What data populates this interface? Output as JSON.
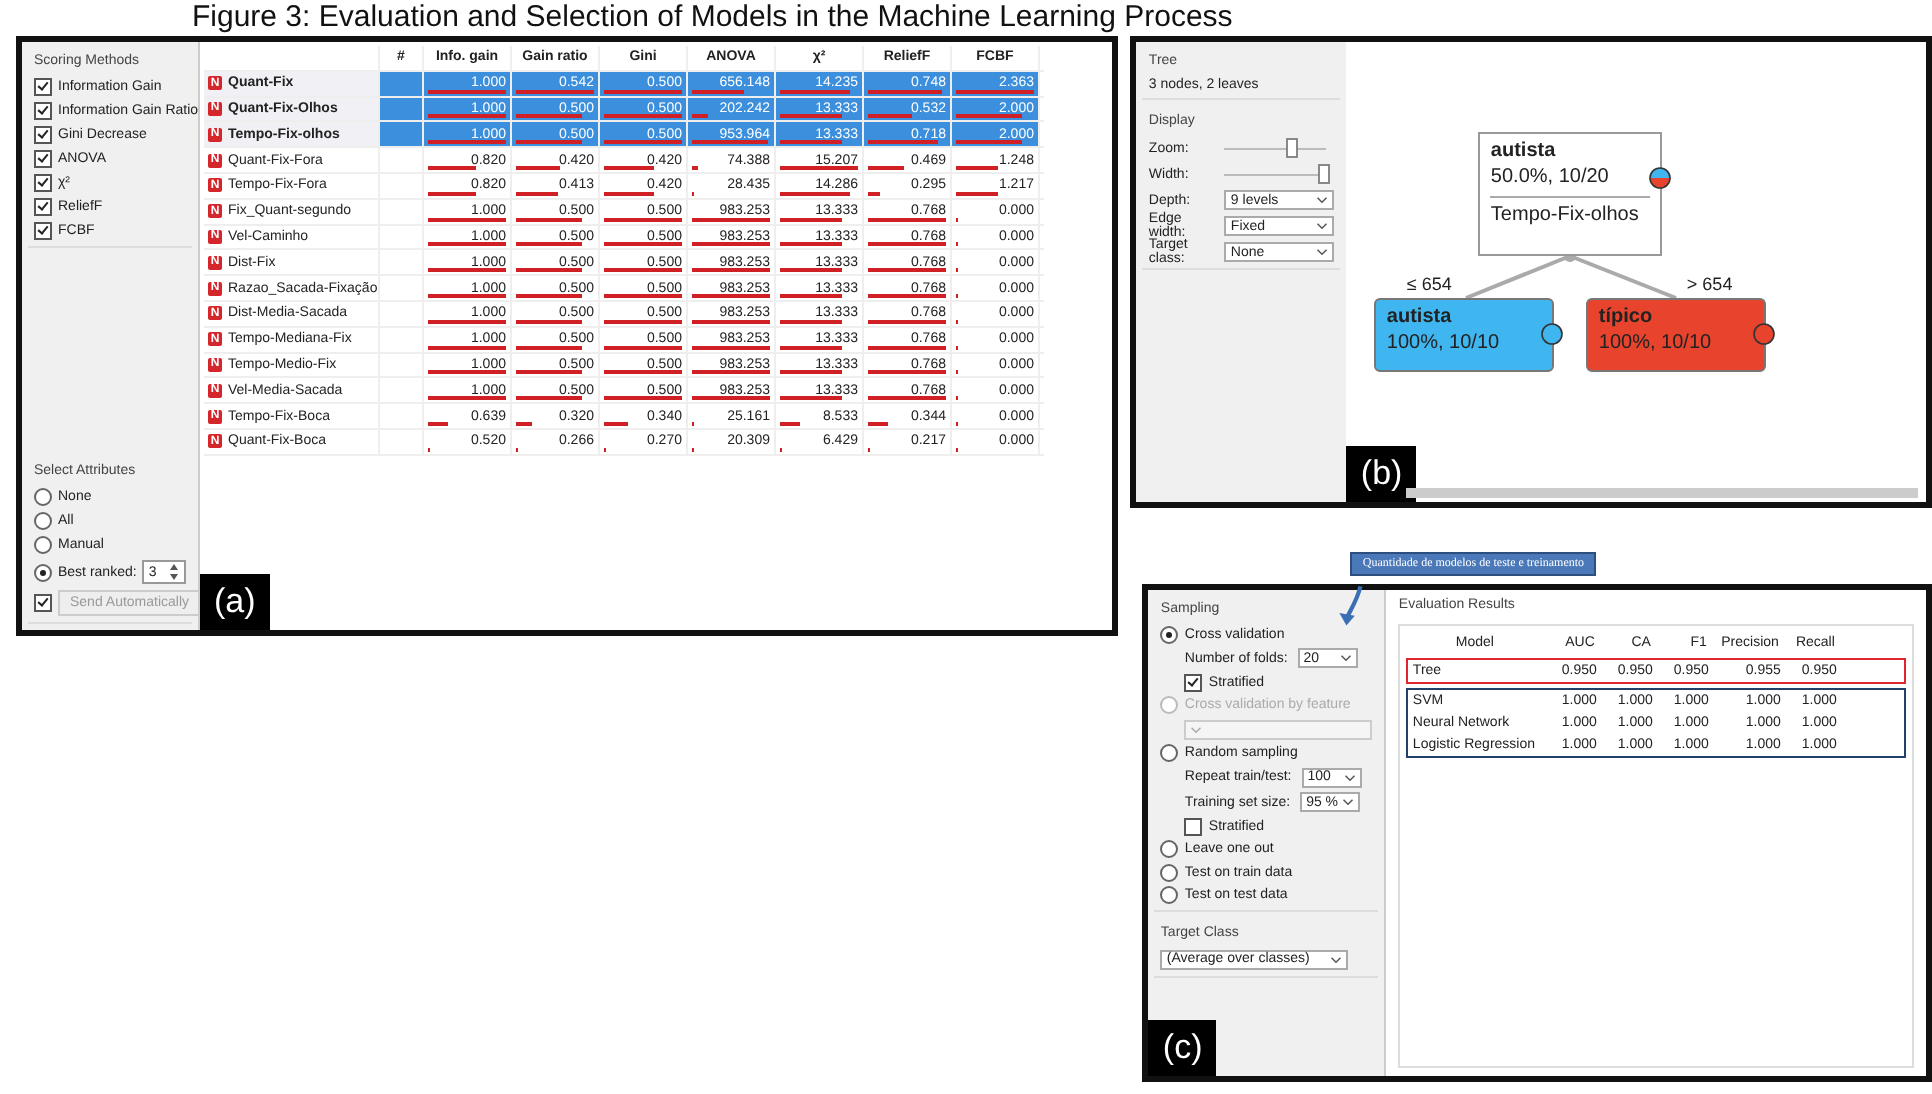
{
  "caption": "Figure 3: Evaluation and Selection of Models in the Machine Learning Process",
  "panel_a": {
    "label": "(a)",
    "scoring_methods": {
      "title": "Scoring Methods",
      "items": [
        {
          "label": "Information Gain",
          "checked": true
        },
        {
          "label": "Information Gain Ratio",
          "checked": true
        },
        {
          "label": "Gini Decrease",
          "checked": true
        },
        {
          "label": "ANOVA",
          "checked": true
        },
        {
          "label": "χ²",
          "checked": true
        },
        {
          "label": "ReliefF",
          "checked": true
        },
        {
          "label": "FCBF",
          "checked": true
        }
      ]
    },
    "select_attributes": {
      "title": "Select Attributes",
      "options": [
        {
          "label": "None",
          "selected": false
        },
        {
          "label": "All",
          "selected": false
        },
        {
          "label": "Manual",
          "selected": false
        },
        {
          "label": "Best ranked:",
          "selected": true,
          "value": "3"
        }
      ],
      "auto_send_checked": true,
      "send_button": "Send Automatically"
    },
    "table": {
      "rank_header": "#",
      "columns": [
        "Info. gain",
        "Gain ratio",
        "Gini",
        "ANOVA",
        "χ²",
        "ReliefF",
        "FCBF"
      ],
      "rows": [
        {
          "name": "Quant-Fix",
          "badge": "N",
          "selected": true,
          "cells": [
            {
              "value": "1.000",
              "level": 1
            },
            {
              "value": "0.542",
              "level": 1
            },
            {
              "value": "0.500",
              "level": 1
            },
            {
              "value": "656.148",
              "level": 0.66
            },
            {
              "value": "14.235",
              "level": 0.89
            },
            {
              "value": "0.748",
              "level": 0.96
            },
            {
              "value": "2.363",
              "level": 1
            }
          ]
        },
        {
          "name": "Quant-Fix-Olhos",
          "badge": "N",
          "selected": true,
          "cells": [
            {
              "value": "1.000",
              "level": 1
            },
            {
              "value": "0.500",
              "level": 0.85
            },
            {
              "value": "0.500",
              "level": 1
            },
            {
              "value": "202.242",
              "level": 0.19
            },
            {
              "value": "13.333",
              "level": 0.79
            },
            {
              "value": "0.532",
              "level": 0.57
            },
            {
              "value": "2.000",
              "level": 0.85
            }
          ]
        },
        {
          "name": "Tempo-Fix-olhos",
          "badge": "N",
          "selected": true,
          "cells": [
            {
              "value": "1.000",
              "level": 1
            },
            {
              "value": "0.500",
              "level": 0.85
            },
            {
              "value": "0.500",
              "level": 1
            },
            {
              "value": "953.964",
              "level": 0.97
            },
            {
              "value": "13.333",
              "level": 0.79
            },
            {
              "value": "0.718",
              "level": 0.91
            },
            {
              "value": "2.000",
              "level": 0.85
            }
          ]
        },
        {
          "name": "Quant-Fix-Fora",
          "badge": "N",
          "selected": false,
          "cells": [
            {
              "value": "0.820",
              "level": 0.62
            },
            {
              "value": "0.420",
              "level": 0.56
            },
            {
              "value": "0.420",
              "level": 0.65
            },
            {
              "value": "74.388",
              "level": 0.06
            },
            {
              "value": "15.207",
              "level": 1
            },
            {
              "value": "0.469",
              "level": 0.46
            },
            {
              "value": "1.248",
              "level": 0.53
            }
          ]
        },
        {
          "name": "Tempo-Fix-Fora",
          "badge": "N",
          "selected": false,
          "cells": [
            {
              "value": "0.820",
              "level": 0.62
            },
            {
              "value": "0.413",
              "level": 0.53
            },
            {
              "value": "0.420",
              "level": 0.65
            },
            {
              "value": "28.435",
              "level": 0.01
            },
            {
              "value": "14.286",
              "level": 0.9
            },
            {
              "value": "0.295",
              "level": 0.14
            },
            {
              "value": "1.217",
              "level": 0.52
            }
          ]
        },
        {
          "name": "Fix_Quant-segundo",
          "badge": "N",
          "selected": false,
          "cells": [
            {
              "value": "1.000",
              "level": 1
            },
            {
              "value": "0.500",
              "level": 0.85
            },
            {
              "value": "0.500",
              "level": 1
            },
            {
              "value": "983.253",
              "level": 1
            },
            {
              "value": "13.333",
              "level": 0.79
            },
            {
              "value": "0.768",
              "level": 1
            },
            {
              "value": "0.000",
              "level": 0
            }
          ]
        },
        {
          "name": "Vel-Caminho",
          "badge": "N",
          "selected": false,
          "cells": [
            {
              "value": "1.000",
              "level": 1
            },
            {
              "value": "0.500",
              "level": 0.85
            },
            {
              "value": "0.500",
              "level": 1
            },
            {
              "value": "983.253",
              "level": 1
            },
            {
              "value": "13.333",
              "level": 0.79
            },
            {
              "value": "0.768",
              "level": 1
            },
            {
              "value": "0.000",
              "level": 0
            }
          ]
        },
        {
          "name": "Dist-Fix",
          "badge": "N",
          "selected": false,
          "cells": [
            {
              "value": "1.000",
              "level": 1
            },
            {
              "value": "0.500",
              "level": 0.85
            },
            {
              "value": "0.500",
              "level": 1
            },
            {
              "value": "983.253",
              "level": 1
            },
            {
              "value": "13.333",
              "level": 0.79
            },
            {
              "value": "0.768",
              "level": 1
            },
            {
              "value": "0.000",
              "level": 0
            }
          ]
        },
        {
          "name": "Razao_Sacada-Fixação",
          "badge": "N",
          "selected": false,
          "cells": [
            {
              "value": "1.000",
              "level": 1
            },
            {
              "value": "0.500",
              "level": 0.85
            },
            {
              "value": "0.500",
              "level": 1
            },
            {
              "value": "983.253",
              "level": 1
            },
            {
              "value": "13.333",
              "level": 0.79
            },
            {
              "value": "0.768",
              "level": 1
            },
            {
              "value": "0.000",
              "level": 0
            }
          ]
        },
        {
          "name": "Dist-Media-Sacada",
          "badge": "N",
          "selected": false,
          "cells": [
            {
              "value": "1.000",
              "level": 1
            },
            {
              "value": "0.500",
              "level": 0.85
            },
            {
              "value": "0.500",
              "level": 1
            },
            {
              "value": "983.253",
              "level": 1
            },
            {
              "value": "13.333",
              "level": 0.79
            },
            {
              "value": "0.768",
              "level": 1
            },
            {
              "value": "0.000",
              "level": 0
            }
          ]
        },
        {
          "name": "Tempo-Mediana-Fix",
          "badge": "N",
          "selected": false,
          "cells": [
            {
              "value": "1.000",
              "level": 1
            },
            {
              "value": "0.500",
              "level": 0.85
            },
            {
              "value": "0.500",
              "level": 1
            },
            {
              "value": "983.253",
              "level": 1
            },
            {
              "value": "13.333",
              "level": 0.79
            },
            {
              "value": "0.768",
              "level": 1
            },
            {
              "value": "0.000",
              "level": 0
            }
          ]
        },
        {
          "name": "Tempo-Medio-Fix",
          "badge": "N",
          "selected": false,
          "cells": [
            {
              "value": "1.000",
              "level": 1
            },
            {
              "value": "0.500",
              "level": 0.85
            },
            {
              "value": "0.500",
              "level": 1
            },
            {
              "value": "983.253",
              "level": 1
            },
            {
              "value": "13.333",
              "level": 0.79
            },
            {
              "value": "0.768",
              "level": 1
            },
            {
              "value": "0.000",
              "level": 0
            }
          ]
        },
        {
          "name": "Vel-Media-Sacada",
          "badge": "N",
          "selected": false,
          "cells": [
            {
              "value": "1.000",
              "level": 1
            },
            {
              "value": "0.500",
              "level": 0.85
            },
            {
              "value": "0.500",
              "level": 1
            },
            {
              "value": "983.253",
              "level": 1
            },
            {
              "value": "13.333",
              "level": 0.79
            },
            {
              "value": "0.768",
              "level": 1
            },
            {
              "value": "0.000",
              "level": 0
            }
          ]
        },
        {
          "name": "Tempo-Fix-Boca",
          "badge": "N",
          "selected": false,
          "cells": [
            {
              "value": "0.639",
              "level": 0.25
            },
            {
              "value": "0.320",
              "level": 0.2
            },
            {
              "value": "0.340",
              "level": 0.3
            },
            {
              "value": "25.161",
              "level": 0.01
            },
            {
              "value": "8.533",
              "level": 0.24
            },
            {
              "value": "0.344",
              "level": 0.23
            },
            {
              "value": "0.000",
              "level": 0
            }
          ]
        },
        {
          "name": "Quant-Fix-Boca",
          "badge": "N",
          "selected": false,
          "cells": [
            {
              "value": "0.520",
              "level": 0
            },
            {
              "value": "0.266",
              "level": 0
            },
            {
              "value": "0.270",
              "level": 0
            },
            {
              "value": "20.309",
              "level": 0
            },
            {
              "value": "6.429",
              "level": 0
            },
            {
              "value": "0.217",
              "level": 0
            },
            {
              "value": "0.000",
              "level": 0
            }
          ]
        }
      ]
    }
  },
  "panel_b": {
    "label": "(b)",
    "info": {
      "title": "Tree",
      "summary": "3 nodes, 2 leaves"
    },
    "display": {
      "title": "Display",
      "sliders": [
        {
          "label": "Zoom:",
          "level": 0.65
        },
        {
          "label": "Width:",
          "level": 0.97
        }
      ],
      "selects": [
        {
          "label": "Depth:",
          "value": "9 levels"
        },
        {
          "label": "Edge width:",
          "value": "Fixed"
        },
        {
          "label": "Target class:",
          "value": "None"
        }
      ]
    },
    "tree": {
      "root": {
        "class": "autista",
        "stats": "50.0%, 10/20",
        "split": "Tempo-Fix-olhos"
      },
      "children": [
        {
          "edge": "≤ 654",
          "class": "autista",
          "stats": "100%, 10/10",
          "color": "#3fb6ef"
        },
        {
          "edge": "> 654",
          "class": "típico",
          "stats": "100%, 10/10",
          "color": "#e8432d"
        }
      ]
    }
  },
  "panel_c": {
    "label": "(c)",
    "callout": "Quantidade de modelos de teste e treinamento",
    "sampling": {
      "title": "Sampling",
      "items": [
        {
          "kind": "radio",
          "label": "Cross validation",
          "selected": true,
          "disabled": false
        },
        {
          "kind": "select",
          "label": "Number of folds:",
          "value": "20"
        },
        {
          "kind": "check",
          "label": "Stratified",
          "checked": true
        },
        {
          "kind": "radio",
          "label": "Cross validation by feature",
          "selected": false,
          "disabled": true
        },
        {
          "kind": "blank-select"
        },
        {
          "kind": "radio",
          "label": "Random sampling",
          "selected": false,
          "disabled": false
        },
        {
          "kind": "select",
          "label": "Repeat train/test:",
          "value": "100"
        },
        {
          "kind": "select",
          "label": "Training set size:",
          "value": "95 %"
        },
        {
          "kind": "check",
          "label": "Stratified",
          "checked": false
        },
        {
          "kind": "radio",
          "label": "Leave one out",
          "selected": false,
          "disabled": false
        },
        {
          "kind": "radio",
          "label": "Test on train data",
          "selected": false,
          "disabled": false
        },
        {
          "kind": "radio",
          "label": "Test on test data",
          "selected": false,
          "disabled": false
        }
      ]
    },
    "target_class": {
      "title": "Target Class",
      "value": "(Average over classes)"
    },
    "results": {
      "title": "Evaluation Results",
      "columns": [
        "Model",
        "AUC",
        "CA",
        "F1",
        "Precision",
        "Recall"
      ],
      "groups": [
        {
          "color": "#e0262b",
          "rows": [
            [
              "Tree",
              "0.950",
              "0.950",
              "0.950",
              "0.955",
              "0.950"
            ]
          ]
        },
        {
          "color": "#22406a",
          "rows": [
            [
              "SVM",
              "1.000",
              "1.000",
              "1.000",
              "1.000",
              "1.000"
            ],
            [
              "Neural Network",
              "1.000",
              "1.000",
              "1.000",
              "1.000",
              "1.000"
            ],
            [
              "Logistic Regression",
              "1.000",
              "1.000",
              "1.000",
              "1.000",
              "1.000"
            ]
          ]
        }
      ]
    }
  }
}
